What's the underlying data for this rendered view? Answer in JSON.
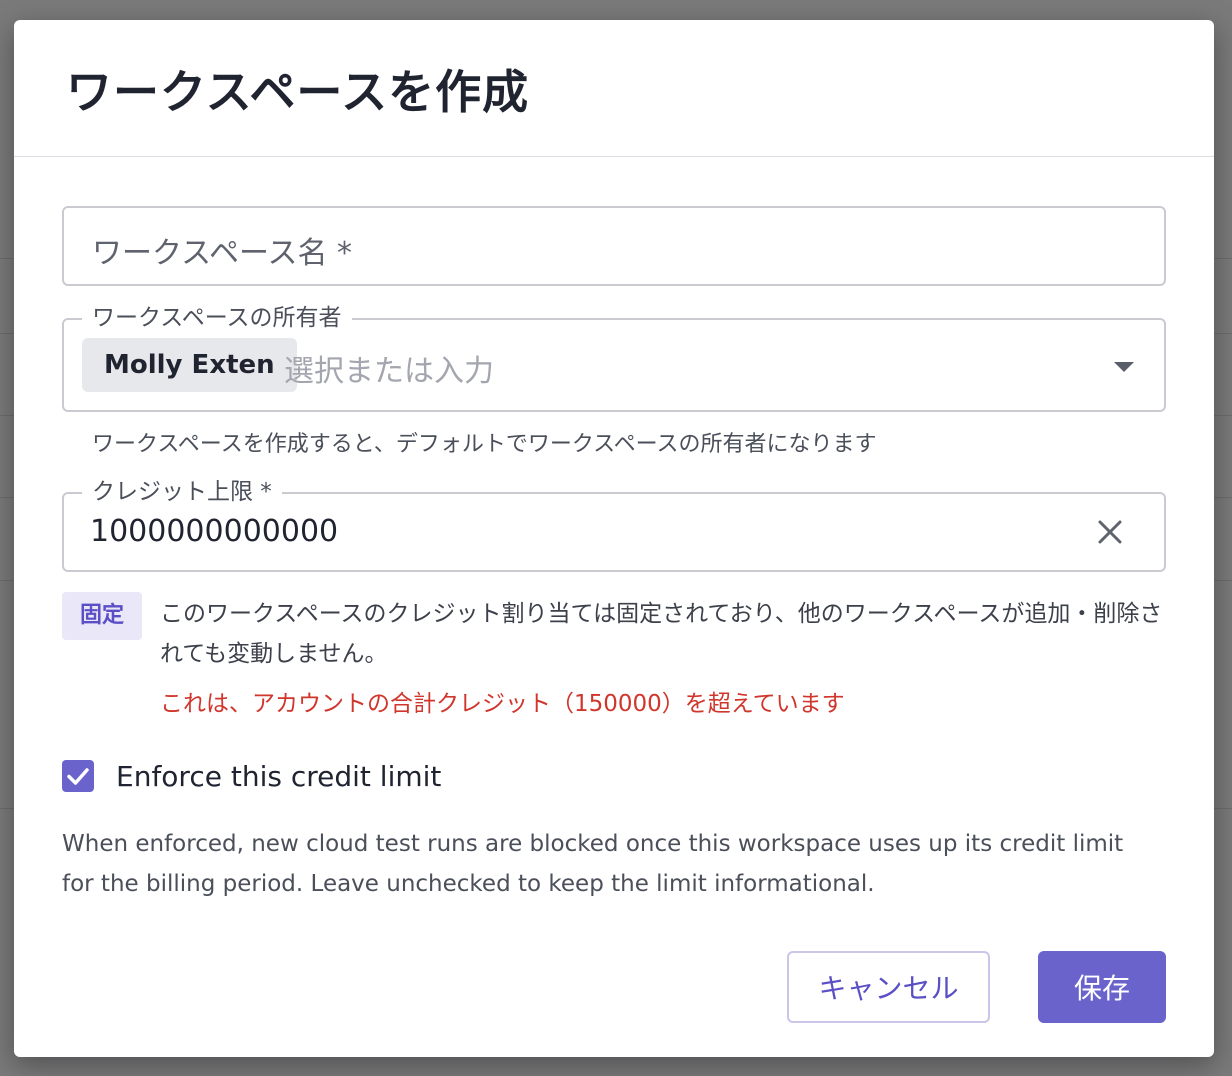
{
  "dialog": {
    "title": "ワークスペースを作成",
    "workspace_name": {
      "placeholder": "ワークスペース名 *",
      "value": ""
    },
    "owner": {
      "label": "ワークスペースの所有者",
      "chip": "Molly Exten",
      "placeholder": "選択または入力",
      "helper": "ワークスペースを作成すると、デフォルトでワークスペースの所有者になります"
    },
    "credit_limit": {
      "label": "クレジット上限 *",
      "value": "1000000000000"
    },
    "fixed": {
      "badge": "固定",
      "description": "このワークスペースのクレジット割り当ては固定されており、他のワークスペースが追加・削除されても変動しません。",
      "error": "これは、アカウントの合計クレジット（150000）を超えています"
    },
    "enforce": {
      "label": "Enforce this credit limit",
      "checked": true,
      "description": "When enforced, new cloud test runs are blocked once this workspace uses up its credit limit for the billing period. Leave unchecked to keep the limit informational."
    },
    "buttons": {
      "cancel": "キャンセル",
      "save": "保存"
    }
  },
  "colors": {
    "accent": "#6b63cc",
    "error": "#d0362c",
    "badge_bg": "#e9e7f8"
  },
  "icons": {
    "dropdown": "chevron-down-icon",
    "clear": "close-icon",
    "checkbox": "check-icon"
  }
}
